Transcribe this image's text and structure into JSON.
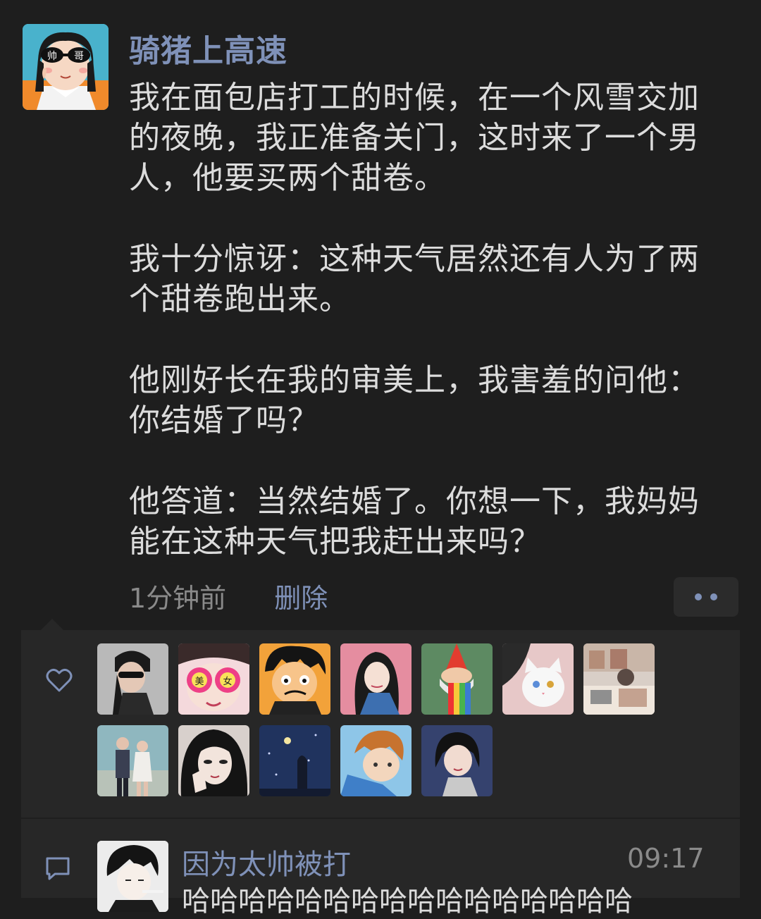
{
  "post": {
    "author": "骑猪上高速",
    "avatar_icon": "avatar-sunglasses-girl",
    "paragraphs": [
      "我在面包店打工的时候，在一个风雪交加的夜晚，我正准备关门，这时来了一个男人，他要买两个甜卷。",
      "我十分惊讶：这种天气居然还有人为了两个甜卷跑出来。",
      "他刚好长在我的审美上，我害羞的问他：你结婚了吗？",
      "他答道：当然结婚了。你想一下，我妈妈能在这种天气把我赶出来吗？"
    ],
    "time": "1分钟前",
    "delete_label": "删除",
    "more_icon": "more-dots-icon"
  },
  "likes": {
    "icon": "heart-icon",
    "users": [
      {
        "icon": "avatar-girl-sunglasses"
      },
      {
        "icon": "avatar-pink-glasses"
      },
      {
        "icon": "avatar-anime-boy"
      },
      {
        "icon": "avatar-illustrated-woman"
      },
      {
        "icon": "avatar-gnome-rainbow"
      },
      {
        "icon": "avatar-white-cat"
      },
      {
        "icon": "avatar-desk-scene"
      },
      {
        "icon": "avatar-couple"
      },
      {
        "icon": "avatar-dark-hair-girl"
      },
      {
        "icon": "avatar-night-sky"
      },
      {
        "icon": "avatar-blue-boy"
      },
      {
        "icon": "avatar-short-hair-girl"
      }
    ]
  },
  "comments": [
    {
      "icon": "comment-icon",
      "avatar_icon": "avatar-sketch-boy",
      "name": "因为太帅被打",
      "time": "09:17",
      "text": "哈哈哈哈哈哈哈哈哈哈哈哈哈哈哈哈"
    }
  ],
  "colors": {
    "background": "#1e1e1e",
    "panel": "#272727",
    "link": "#7f91b8",
    "text": "#dcdcdc",
    "muted": "#8a8a8a"
  }
}
